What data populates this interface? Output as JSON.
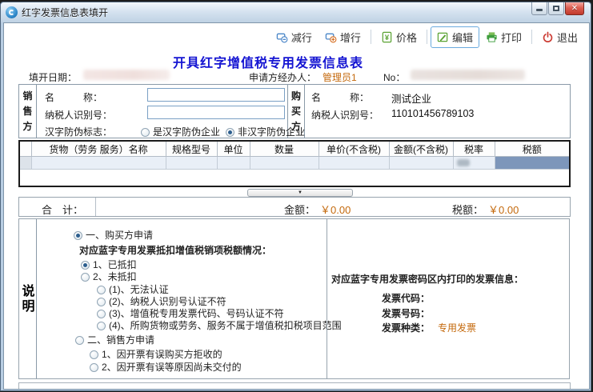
{
  "window": {
    "title": "红字发票信息表填开"
  },
  "toolbar": {
    "buttons": [
      {
        "label": "减行"
      },
      {
        "label": "增行"
      },
      {
        "label": "价格"
      },
      {
        "label": "编辑"
      },
      {
        "label": "打印"
      },
      {
        "label": "退出"
      }
    ]
  },
  "header": {
    "form_title": "开具红字增值税专用发票信息表",
    "fill_date_label": "填开日期：",
    "applicant_label": "申请方经办人：",
    "applicant_value": "管理员1",
    "no_label": "No："
  },
  "seller": {
    "section_label": "销售方",
    "name_label": "名　　　称：",
    "taxid_label": "纳税人识别号：",
    "antifake_label": "汉字防伪标志：",
    "antifake_options": [
      {
        "label": "是汉字防伪企业",
        "selected": false
      },
      {
        "label": "非汉字防伪企业",
        "selected": true
      }
    ]
  },
  "buyer": {
    "section_label": "购买方",
    "name_label": "名　　　称：",
    "name_value": "测试企业",
    "taxid_label": "纳税人识别号：",
    "taxid_value": "110101456789103"
  },
  "table": {
    "headers": [
      "货物（劳务 服务）名称",
      "规格型号",
      "单位",
      "数量",
      "单价(不含税)",
      "金额(不含税)",
      "税率",
      "税额"
    ]
  },
  "totals": {
    "label": "合　计：",
    "amount_label": "金额：",
    "amount_value": "￥0.00",
    "tax_label": "税额：",
    "tax_value": "￥0.00"
  },
  "explanation": {
    "section_label": "说明",
    "items": [
      {
        "label": "一、购买方申请",
        "selected": true
      },
      {
        "label": "对应蓝字专用发票抵扣增值税销项税额情况：",
        "type": "heading"
      },
      {
        "label": "1、已抵扣",
        "selected": true
      },
      {
        "label": "2、未抵扣",
        "selected": false
      },
      {
        "label": "(1)、无法认证",
        "selected": false
      },
      {
        "label": "(2)、纳税人识别号认证不符",
        "selected": false
      },
      {
        "label": "(3)、增值税专用发票代码、号码认证不符",
        "selected": false
      },
      {
        "label": "(4)、所购货物或劳务、服务不属于增值税扣税项目范围",
        "selected": false
      },
      {
        "label": "二、销售方申请",
        "selected": false
      },
      {
        "label": "1、因开票有误购买方拒收的",
        "selected": false
      },
      {
        "label": "2、因开票有误等原因尚未交付的",
        "selected": false
      }
    ]
  },
  "invoice_info": {
    "title": "对应蓝字专用发票密码区内打印的发票信息：",
    "code_label": "发票代码：",
    "number_label": "发票号码：",
    "type_label": "发票种类：",
    "type_value": "专用发票"
  },
  "colors": {
    "accent_orange": "#c4690c",
    "title_blue": "#1414d2",
    "selected_cell": "#7d96ba"
  }
}
